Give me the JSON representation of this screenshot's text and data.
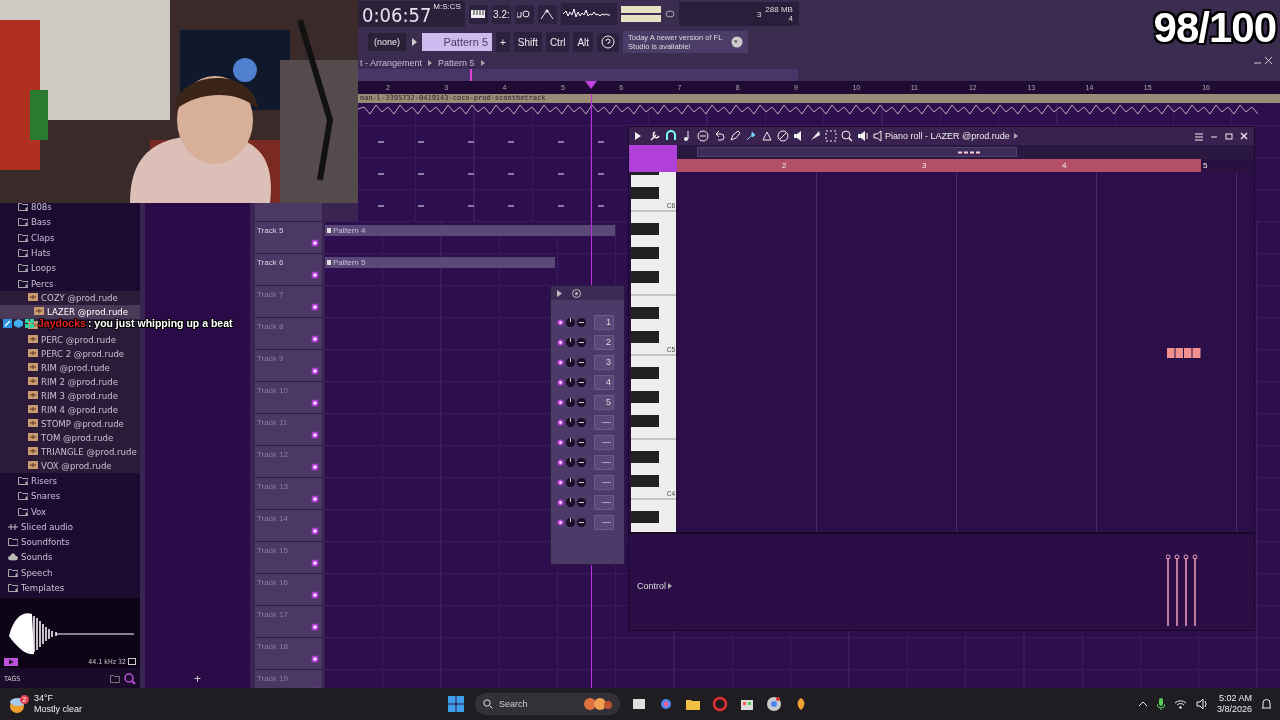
{
  "stream_overlay": {
    "score": "98/100",
    "chat": {
      "user": "Jaydocks",
      "message": ": you just whipping up a beat"
    }
  },
  "toolbar": {
    "time": "0:06:57",
    "time_unit": "M:S:CS",
    "step_label": "3.2:",
    "pattern_none": "(none)",
    "pattern": "Pattern 5",
    "add": "+",
    "keys": [
      "Shift",
      "Ctrl",
      "Alt"
    ],
    "cpu": "3",
    "memory": "288 MB",
    "polyphony": "4",
    "news": {
      "day": "Today",
      "text": "A newer version of FL Studio is available!"
    }
  },
  "browser": {
    "tree": [
      {
        "children": [
          {
            "label": "808s",
            "kind": "folder",
            "selected": false
          },
          {
            "label": "Bass",
            "kind": "folder",
            "selected": false
          },
          {
            "label": "Claps",
            "kind": "folder",
            "selected": false
          },
          {
            "label": "Hats",
            "kind": "folder",
            "selected": false
          },
          {
            "label": "Loops",
            "kind": "folder",
            "selected": false
          },
          {
            "label": "Percs",
            "kind": "folder",
            "selected": false,
            "children": [
              {
                "label": "COZY @prod.rude",
                "kind": "sample",
                "selected": false
              },
              {
                "label": "LAZER @prod.rude",
                "kind": "sample",
                "selected": true
              },
              {
                "kind": "sample",
                "selected": false
              },
              {
                "label": "PERC @prod.rude",
                "kind": "sample",
                "selected": false
              },
              {
                "label": "PERC 2 @prod.rude",
                "kind": "sample",
                "selected": false
              },
              {
                "label": "RIM @prod.rude",
                "kind": "sample",
                "selected": false
              },
              {
                "label": "RIM 2 @prod.rude",
                "kind": "sample",
                "selected": false
              },
              {
                "label": "RIM 3 @prod.rude",
                "kind": "sample",
                "selected": false
              },
              {
                "label": "RIM 4 @prod.rude",
                "kind": "sample",
                "selected": false
              },
              {
                "label": "STOMP @prod.rude",
                "kind": "sample",
                "selected": false
              },
              {
                "label": "TOM @prod.rude",
                "kind": "sample",
                "selected": false
              },
              {
                "label": "TRIANGLE @prod.rude",
                "kind": "sample",
                "selected": false
              },
              {
                "label": "VOX @prod.rude",
                "kind": "sample",
                "selected": false
              }
            ]
          },
          {
            "label": "Risers",
            "kind": "folder",
            "selected": false
          },
          {
            "label": "Snares",
            "kind": "folder",
            "selected": false
          },
          {
            "label": "Vox",
            "kind": "folder",
            "selected": false
          }
        ]
      },
      {
        "label": "Sliced audio",
        "kind": "sliced",
        "selected": false
      },
      {
        "label": "Soundfonts",
        "kind": "plain",
        "selected": false
      },
      {
        "label": "Sounds",
        "kind": "cloud",
        "selected": false
      },
      {
        "label": "Speech",
        "kind": "folder",
        "selected": false
      },
      {
        "label": "Templates",
        "kind": "folder",
        "selected": false
      }
    ],
    "preview": {
      "format": "44.1 kHz 32",
      "tags": "TAGS"
    }
  },
  "playlist": {
    "breadcrumb": [
      "t - Arrangement",
      "Pattern 5"
    ],
    "ruler": [
      "2",
      "3",
      "4",
      "5",
      "6",
      "7",
      "8",
      "9",
      "10",
      "11",
      "12",
      "13",
      "14",
      "15",
      "16"
    ],
    "audio_clip": "man-l-3395732-0419143-coco-prod-sconthetrack",
    "add_track": "+",
    "tracks": [
      {
        "label": "Track 5",
        "dimmed": false,
        "clip": "Pattern 4"
      },
      {
        "label": "Track 6",
        "dimmed": false,
        "clip": "Pattern 5"
      },
      {
        "label": "Track 7",
        "dimmed": true
      },
      {
        "label": "Track 8",
        "dimmed": true
      },
      {
        "label": "Track 9",
        "dimmed": true
      },
      {
        "label": "Track 10",
        "dimmed": true
      },
      {
        "label": "Track 11",
        "dimmed": true
      },
      {
        "label": "Track 12",
        "dimmed": true
      },
      {
        "label": "Track 13",
        "dimmed": true
      },
      {
        "label": "Track 14",
        "dimmed": true
      },
      {
        "label": "Track 15",
        "dimmed": true
      },
      {
        "label": "Track 16",
        "dimmed": true
      },
      {
        "label": "Track 17",
        "dimmed": true
      },
      {
        "label": "Track 18",
        "dimmed": true
      },
      {
        "label": "Track 19",
        "dimmed": true
      }
    ]
  },
  "channel_rack": {
    "rows": [
      "1",
      "2",
      "3",
      "4",
      "5",
      "---",
      "---",
      "---",
      "---",
      "---",
      "---"
    ]
  },
  "piano_roll": {
    "title": "Piano roll - LAZER @prod.rude",
    "bars": [
      "2",
      "3",
      "4",
      "5"
    ],
    "keys": [
      "C6",
      "C5",
      "C4"
    ],
    "control": "Control"
  },
  "taskbar": {
    "weather": {
      "temp": "34°F",
      "desc": "Mostly clear",
      "badge": "2"
    },
    "search": "Search",
    "time": "5:02 AM",
    "date": "3/8/2026"
  }
}
